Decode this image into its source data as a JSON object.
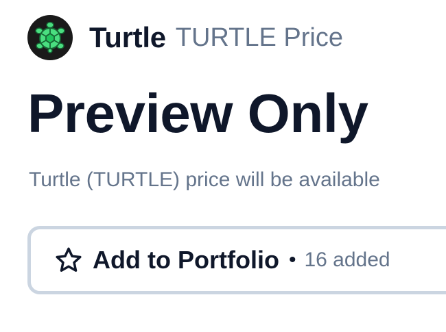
{
  "coin": {
    "name": "Turtle",
    "suffix": "TURTLE Price",
    "logo_icon": "turtle-shell-icon",
    "logo_colors": {
      "background": "#1a1a1a",
      "shell": "#4ade80",
      "shell_outline": "#166534"
    }
  },
  "main": {
    "title": "Preview Only",
    "subtitle": "Turtle (TURTLE) price will be available"
  },
  "portfolio_button": {
    "icon": "star-icon",
    "label": "Add to Portfolio",
    "separator": "•",
    "added_text": "16 added"
  }
}
